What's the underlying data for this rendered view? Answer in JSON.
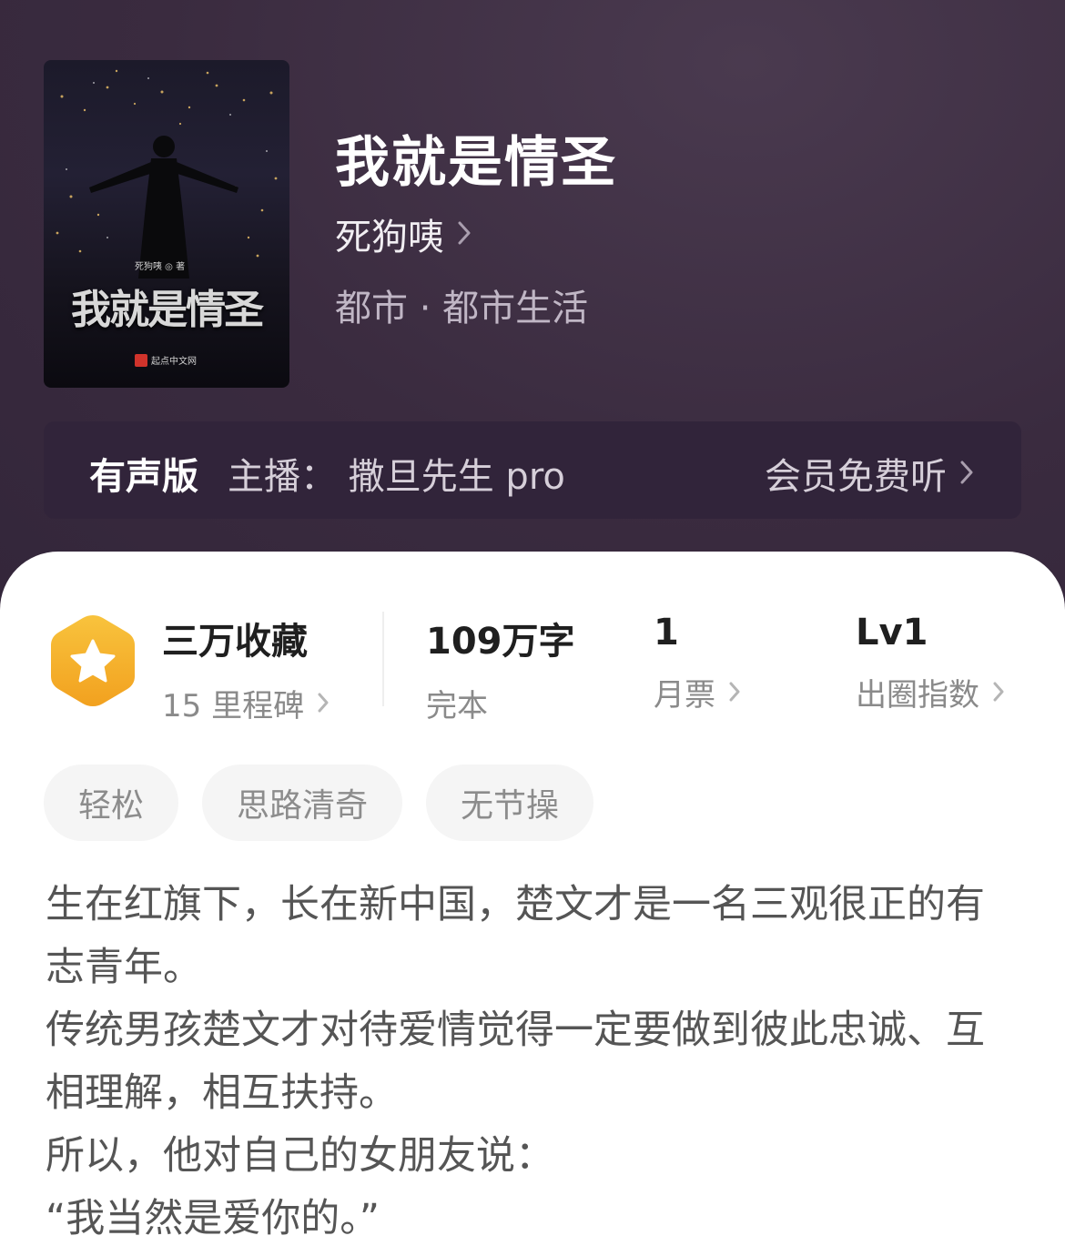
{
  "book": {
    "title": "我就是情圣",
    "author": "死狗咦",
    "genre": "都市 · 都市生活",
    "cover": {
      "title": "我就是情圣",
      "author_line": "死狗咦 ◎ 著",
      "publisher": "起点中文网"
    }
  },
  "audio": {
    "label": "有声版",
    "anchor": "主播：  撒旦先生 pro",
    "action": "会员免费听"
  },
  "stats": {
    "favorites": {
      "value": "三万收藏",
      "sub": "15 里程碑"
    },
    "words": {
      "value": "109万字",
      "sub": "完本"
    },
    "tickets": {
      "value": "1",
      "sub": "月票"
    },
    "level": {
      "value": "Lv1",
      "sub": "出圈指数"
    }
  },
  "tags": [
    "轻松",
    "思路清奇",
    "无节操"
  ],
  "description": [
    "生在红旗下，长在新中国，楚文才是一名三观很正的有志青年。",
    "传统男孩楚文才对待爱情觉得一定要做到彼此忠诚、互相理解，相互扶持。",
    "所以，他对自己的女朋友说：",
    "“我当然是爱你的。”"
  ],
  "colors": {
    "header_bg": "#3a2c3f",
    "badge": "#f5b32a",
    "text_dark": "#1f1f1f",
    "text_muted": "#8a8a8a"
  }
}
